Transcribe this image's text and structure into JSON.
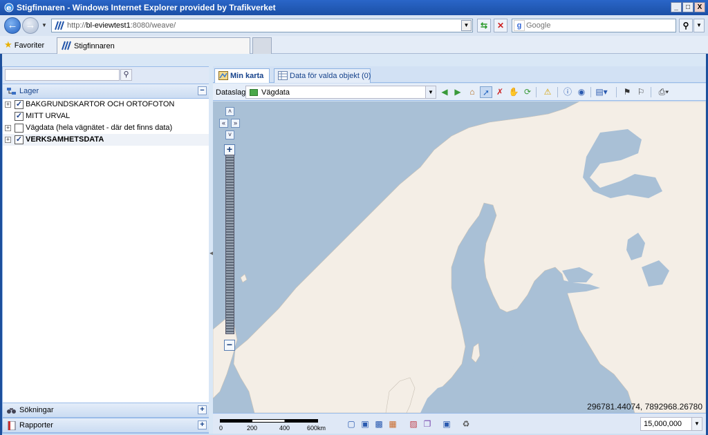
{
  "window": {
    "title": "Stigfinnaren - Windows Internet Explorer provided by Trafikverket",
    "minimize": "_",
    "maximize": "□",
    "close": "X"
  },
  "address": {
    "url_host": "http://",
    "url_host_bold": "bl-eviewtest1",
    "url_rest": ":8080/weave/",
    "search_placeholder": "Google"
  },
  "favorites": {
    "label": "Favoriter",
    "tab_title": "Stigfinnaren"
  },
  "left": {
    "search_value": "",
    "layers_header": "Lager",
    "layers": [
      {
        "label": "BAKGRUNDSKARTOR OCH ORTOFOTON",
        "checked": true,
        "expandable": true
      },
      {
        "label": "MITT URVAL",
        "checked": true,
        "expandable": false
      },
      {
        "label": "Vägdata (hela vägnätet - där det finns data)",
        "checked": false,
        "expandable": true
      },
      {
        "label": "VERKSAMHETSDATA",
        "checked": true,
        "expandable": true
      }
    ],
    "searches_header": "Sökningar",
    "reports_header": "Rapporter"
  },
  "main": {
    "tabs": [
      {
        "label": "Min karta",
        "active": true
      },
      {
        "label": "Data för valda objekt (0)",
        "active": false
      }
    ],
    "dataslag_label": "Dataslag",
    "dataslag_value": "Vägdata",
    "coordinates": "296781.44074, 7892968.26780",
    "scale_labels": [
      "0",
      "200",
      "400",
      "600km"
    ],
    "scale_value": "15,000,000"
  },
  "colors": {
    "sea": "#a9c0d6",
    "land": "#f4eee6",
    "panel_border": "#99bbe8",
    "header_text": "#15428b"
  }
}
